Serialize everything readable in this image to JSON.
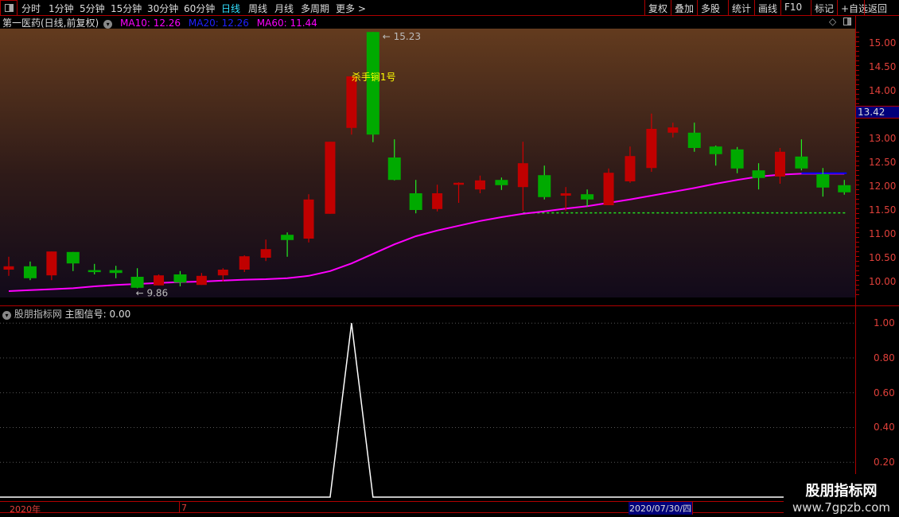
{
  "toolbar": {
    "periods": [
      "分时",
      "1分钟",
      "5分钟",
      "15分钟",
      "30分钟",
      "60分钟",
      "日线",
      "周线",
      "月线",
      "多周期",
      "更多 >"
    ],
    "active": "日线",
    "right_buttons": [
      "复权",
      "叠加",
      "多股",
      "统计",
      "画线",
      "F10",
      "标记",
      "+自选",
      "返回"
    ]
  },
  "header": {
    "title": "第一医药(日线,前复权)",
    "ma10": "MA10: 12.26",
    "ma20": "MA20: 12.26",
    "ma60": "MA60: 11.44"
  },
  "colors": {
    "up": "#c00000",
    "down": "#00aa00",
    "ma": "#ff00ff",
    "ma20": "#0000ff",
    "signal": "#ffff00"
  },
  "chart_data": [
    {
      "type": "candlestick",
      "title": "第一医药(日线,前复权)",
      "ylim": [
        9.7,
        15.3
      ],
      "yticks": [
        "15.00",
        "14.50",
        "14.00",
        "13.50",
        "13.00",
        "12.50",
        "12.00",
        "11.50",
        "11.00",
        "10.50",
        "10.00"
      ],
      "ohlc": [
        [
          10.25,
          10.52,
          10.12,
          10.32
        ],
        [
          10.32,
          10.42,
          10.03,
          10.07
        ],
        [
          10.13,
          10.63,
          10.03,
          10.63
        ],
        [
          10.62,
          10.62,
          10.22,
          10.38
        ],
        [
          10.24,
          10.37,
          10.15,
          10.22
        ],
        [
          10.24,
          10.33,
          10.07,
          10.18
        ],
        [
          10.1,
          10.28,
          9.86,
          9.87
        ],
        [
          9.92,
          10.15,
          9.92,
          10.13
        ],
        [
          10.15,
          10.22,
          9.9,
          9.98
        ],
        [
          9.93,
          10.18,
          9.93,
          10.12
        ],
        [
          10.13,
          10.28,
          10.0,
          10.25
        ],
        [
          10.25,
          10.55,
          10.2,
          10.53
        ],
        [
          10.5,
          10.88,
          10.43,
          10.68
        ],
        [
          10.98,
          11.03,
          10.52,
          10.87
        ],
        [
          10.9,
          11.83,
          10.82,
          11.72
        ],
        [
          11.42,
          12.93,
          11.42,
          12.93
        ],
        [
          13.22,
          14.3,
          13.08,
          14.3
        ],
        [
          15.23,
          15.23,
          12.92,
          13.08
        ],
        [
          12.6,
          12.98,
          12.12,
          12.13
        ],
        [
          11.85,
          12.13,
          11.43,
          11.5
        ],
        [
          11.52,
          12.03,
          11.47,
          11.85
        ],
        [
          12.03,
          12.08,
          11.65,
          12.07
        ],
        [
          11.93,
          12.22,
          11.85,
          12.12
        ],
        [
          12.13,
          12.18,
          11.92,
          12.02
        ],
        [
          11.98,
          12.93,
          11.48,
          12.48
        ],
        [
          12.23,
          12.43,
          11.72,
          11.77
        ],
        [
          11.8,
          11.98,
          11.48,
          11.85
        ],
        [
          11.83,
          11.93,
          11.57,
          11.72
        ],
        [
          11.6,
          12.37,
          11.6,
          12.28
        ],
        [
          12.1,
          12.83,
          12.07,
          12.63
        ],
        [
          12.38,
          13.52,
          12.3,
          13.2
        ],
        [
          13.12,
          13.33,
          13.02,
          13.23
        ],
        [
          13.12,
          13.33,
          12.72,
          12.8
        ],
        [
          12.83,
          12.85,
          12.43,
          12.67
        ],
        [
          12.77,
          12.82,
          12.27,
          12.37
        ],
        [
          12.33,
          12.48,
          11.93,
          12.17
        ],
        [
          12.2,
          12.8,
          12.05,
          12.72
        ],
        [
          12.62,
          12.98,
          12.33,
          12.37
        ],
        [
          12.25,
          12.38,
          11.78,
          11.97
        ],
        [
          12.02,
          12.13,
          11.82,
          11.87
        ]
      ],
      "ma60": [
        9.8,
        9.82,
        9.84,
        9.86,
        9.9,
        9.93,
        9.95,
        9.97,
        9.99,
        10.0,
        10.02,
        10.04,
        10.05,
        10.07,
        10.12,
        10.22,
        10.38,
        10.58,
        10.78,
        10.95,
        11.07,
        11.17,
        11.27,
        11.35,
        11.42,
        11.47,
        11.53,
        11.58,
        11.65,
        11.72,
        11.8,
        11.88,
        11.96,
        12.05,
        12.13,
        12.2,
        12.24,
        12.26,
        12.26,
        12.26
      ],
      "ma20_tail": 12.27,
      "support_line": 11.44,
      "high_label": "15.23",
      "low_label": "9.86",
      "signal_label": "杀手锏1号",
      "signal_index": 16,
      "price_badge": "13.42"
    },
    {
      "type": "line",
      "title": "股朋指标网 主图信号: 0.00",
      "ylim": [
        0,
        1.05
      ],
      "yticks": [
        "1.00",
        "0.80",
        "0.60",
        "0.40",
        "0.20"
      ],
      "values": [
        0,
        0,
        0,
        0,
        0,
        0,
        0,
        0,
        0,
        0,
        0,
        0,
        0,
        0,
        0,
        0,
        1,
        0,
        0,
        0,
        0,
        0,
        0,
        0,
        0,
        0,
        0,
        0,
        0,
        0,
        0,
        0,
        0,
        0,
        0,
        0,
        0,
        0,
        0,
        0
      ]
    }
  ],
  "sub": {
    "name": "股朋指标网",
    "signal": "主图信号: 0.00"
  },
  "datebar": {
    "year": "2020年",
    "month": "7",
    "cursor": "2020/07/30/四"
  },
  "watermark": {
    "name": "股朋指标网",
    "url": "www.7gpzb.com"
  }
}
